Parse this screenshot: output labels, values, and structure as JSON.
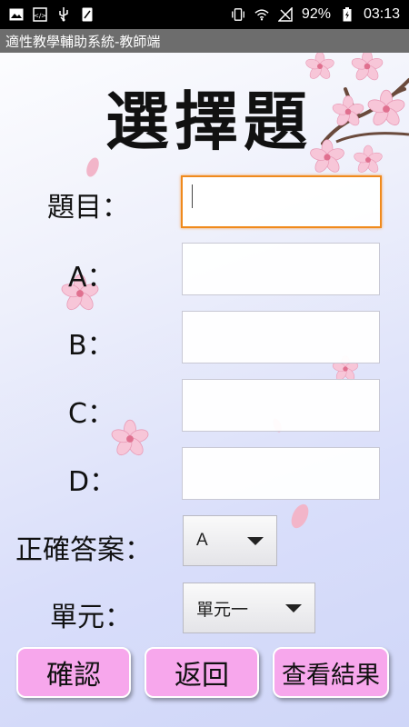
{
  "status_bar": {
    "battery": "92%",
    "time": "03:13"
  },
  "app_title": "適性教學輔助系統-教師端",
  "page_title": "選擇題",
  "form": {
    "question_label": "題目：",
    "a_label": "A：",
    "b_label": "B：",
    "c_label": "C：",
    "d_label": "D：",
    "answer_label": "正確答案：",
    "answer_value": "A",
    "unit_label": "單元：",
    "unit_value": "單元一"
  },
  "buttons": {
    "confirm": "確認",
    "back": "返回",
    "view_results": "查看結果"
  },
  "colors": {
    "button_pink": "#f7a7ec",
    "focus_orange": "#f08a1c",
    "title_bar": "#6d6d6d"
  },
  "icons": [
    "image-icon",
    "code-icon",
    "usb-icon",
    "phone-icon",
    "vibrate-icon",
    "wifi-icon",
    "no-signal-icon",
    "battery-icon"
  ]
}
